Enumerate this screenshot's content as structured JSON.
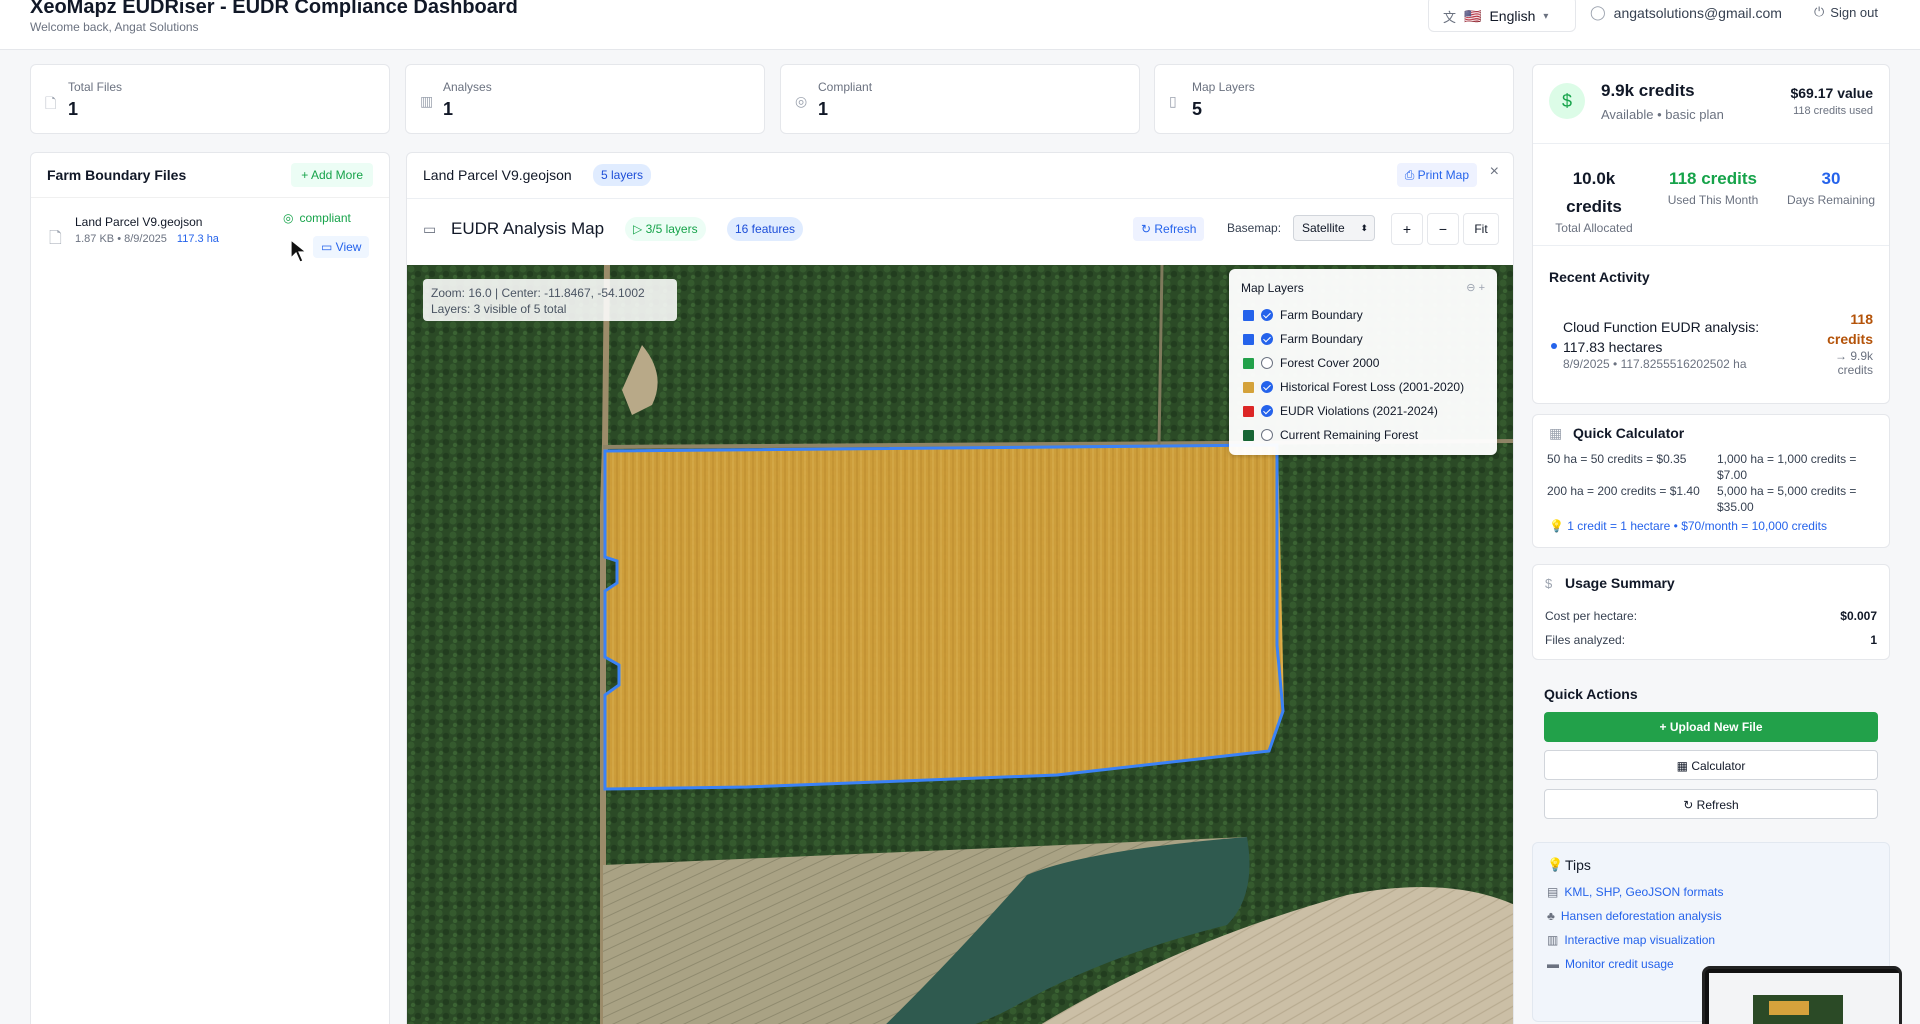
{
  "header": {
    "title": "XeoMapz EUDRiser - EUDR Compliance Dashboard",
    "subtitle": "Welcome back, Angat Solutions",
    "language": "English",
    "language_flag": "🇺🇸",
    "user_email": "angatsolutions@gmail.com",
    "sign_out": "Sign out"
  },
  "stats": [
    {
      "label": "Total Files",
      "value": "1",
      "icon": "file-icon"
    },
    {
      "label": "Analyses",
      "value": "1",
      "icon": "bar-chart-icon"
    },
    {
      "label": "Compliant",
      "value": "1",
      "icon": "check-circle-icon"
    },
    {
      "label": "Map Layers",
      "value": "5",
      "icon": "map-icon"
    }
  ],
  "files_panel": {
    "title": "Farm Boundary Files",
    "add_more": "+ Add More",
    "file": {
      "name": "Land Parcel V9.geojson",
      "meta": "1.87 KB • 8/9/2025",
      "area": "117.3 ha",
      "status": "compliant",
      "view": "View"
    }
  },
  "map_card": {
    "file_title": "Land Parcel V9.geojson",
    "layers_badge": "5 layers",
    "print": "Print Map",
    "close": "×",
    "title": "EUDR Analysis Map",
    "visible_layers": "▷ 3/5 layers",
    "features": "16 features",
    "refresh": "Refresh",
    "basemap_label": "Basemap:",
    "basemap_value": "Satellite",
    "zoom_in": "+",
    "zoom_out": "−",
    "fit": "Fit",
    "zoom_info_1": "Zoom: 16.0 | Center: -11.8467, -54.1002",
    "zoom_info_2": "Layers: 3 visible of 5 total",
    "layers_title": "Map Layers",
    "layers": [
      {
        "name": "Farm Boundary",
        "color": "#2563eb",
        "checked": true
      },
      {
        "name": "Farm Boundary",
        "color": "#2563eb",
        "checked": true
      },
      {
        "name": "Forest Cover 2000",
        "color": "#22a14a",
        "checked": false
      },
      {
        "name": "Historical Forest Loss (2001-2020)",
        "color": "#d4a23a",
        "checked": true
      },
      {
        "name": "EUDR Violations (2021-2024)",
        "color": "#dc2626",
        "checked": true
      },
      {
        "name": "Current Remaining Forest",
        "color": "#166534",
        "checked": false
      }
    ]
  },
  "credits": {
    "amount": "9.9k credits",
    "status": "Available • basic plan",
    "value": "$69.17 value",
    "used": "118 credits used",
    "total_val": "10.0k credits",
    "total_lbl": "Total Allocated",
    "month_val": "118 credits",
    "month_lbl": "Used This Month",
    "days_val": "30",
    "days_lbl": "Days Remaining",
    "recent_title": "Recent Activity",
    "activity_text": "Cloud Function EUDR analysis: 117.83 hectares",
    "activity_meta": "8/9/2025 • 117.8255516202502 ha",
    "activity_credits": "118 credits",
    "activity_remaining": "→ 9.9k credits"
  },
  "calculator": {
    "title": "Quick Calculator",
    "cells": [
      "50 ha = 50 credits = $0.35",
      "1,000 ha = 1,000 credits = $7.00",
      "200 ha = 200 credits = $1.40",
      "5,000 ha = 5,000 credits = $35.00"
    ],
    "note": "1 credit = 1 hectare • $70/month = 10,000 credits"
  },
  "usage": {
    "title": "Usage Summary",
    "cost_lbl": "Cost per hectare:",
    "cost_val": "$0.007",
    "files_lbl": "Files analyzed:",
    "files_val": "1"
  },
  "quick_actions": {
    "title": "Quick Actions",
    "upload": "+ Upload New File",
    "calculator": "Calculator",
    "refresh": "Refresh"
  },
  "tips": {
    "title": "Tips",
    "items": [
      "KML, SHP, GeoJSON formats",
      "Hansen deforestation analysis",
      "Interactive map visualization",
      "Monitor credit usage"
    ]
  },
  "colors": {
    "accent": "#2563eb",
    "success": "#16a34a",
    "forest": "#2b4a26",
    "field": "#d9a93b"
  }
}
